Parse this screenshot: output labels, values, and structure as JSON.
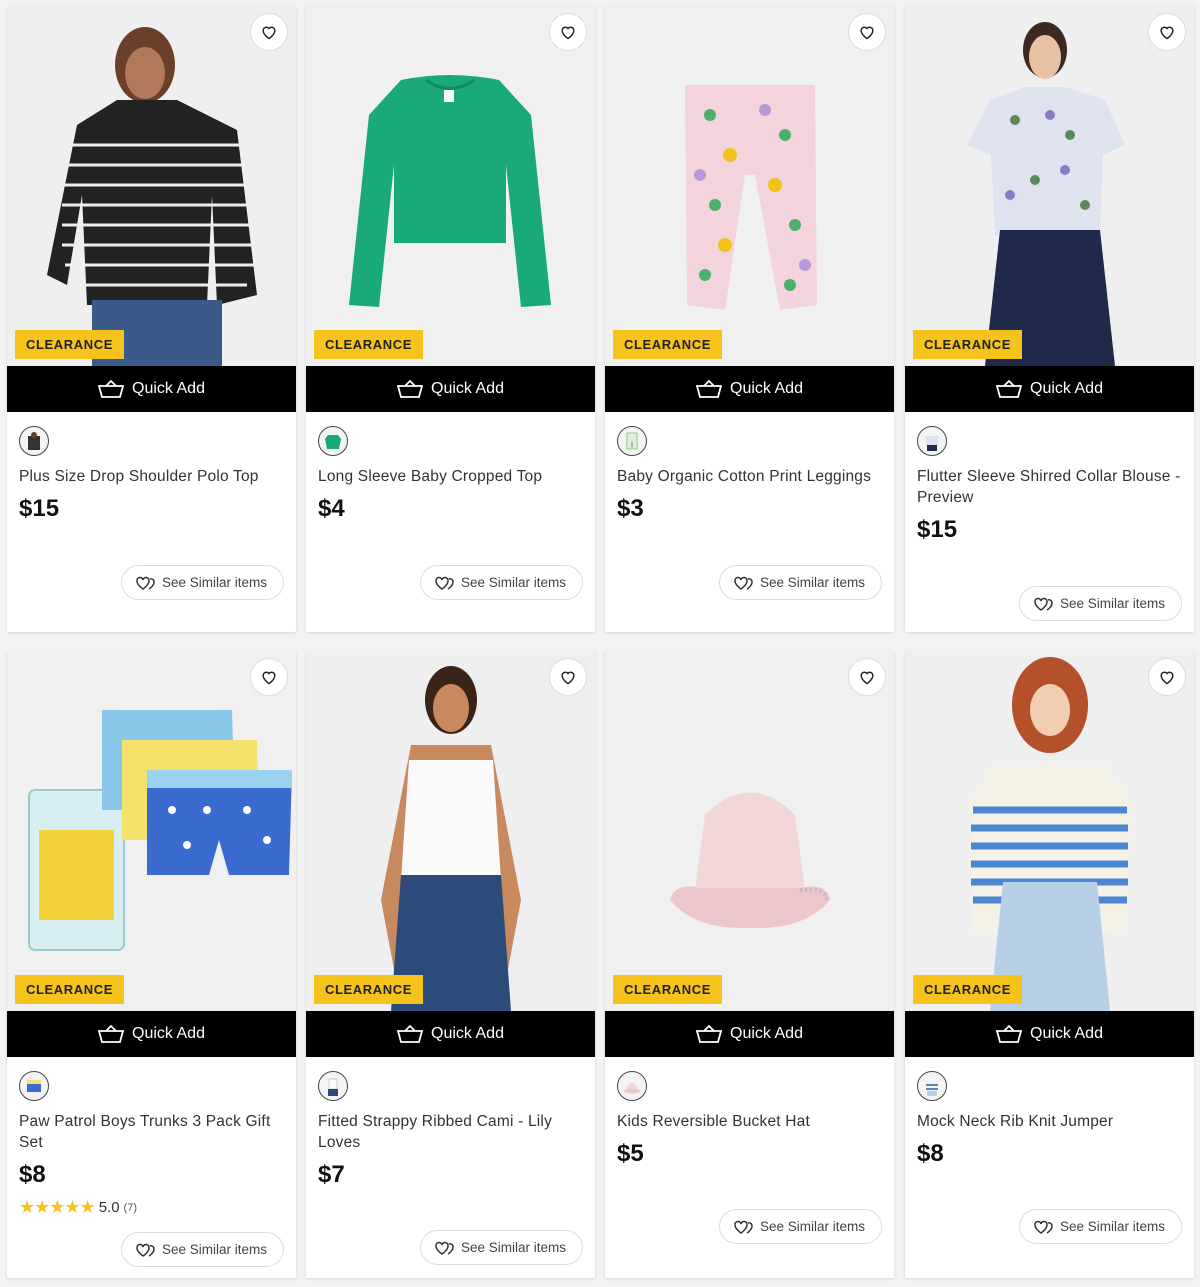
{
  "labels": {
    "badge": "CLEARANCE",
    "quick_add": "Quick Add",
    "see_similar": "See Similar items"
  },
  "colors": {
    "badge_bg": "#f6c21c",
    "quick_add_bg": "#000000",
    "star": "#f6c21c"
  },
  "products": [
    {
      "name": "Plus Size Drop Shoulder Polo Top",
      "price": "$15"
    },
    {
      "name": "Long Sleeve Baby Cropped Top",
      "price": "$4"
    },
    {
      "name": "Baby Organic Cotton Print Leggings",
      "price": "$3"
    },
    {
      "name": "Flutter Sleeve Shirred Collar Blouse - Preview",
      "price": "$15"
    },
    {
      "name": "Paw Patrol Boys Trunks 3 Pack Gift Set",
      "price": "$8",
      "rating": "5.0",
      "rating_stars": 5,
      "review_count": "(7)"
    },
    {
      "name": "Fitted Strappy Ribbed Cami - Lily Loves",
      "price": "$7"
    },
    {
      "name": "Kids Reversible Bucket Hat",
      "price": "$5"
    },
    {
      "name": "Mock Neck Rib Knit Jumper",
      "price": "$8"
    }
  ]
}
